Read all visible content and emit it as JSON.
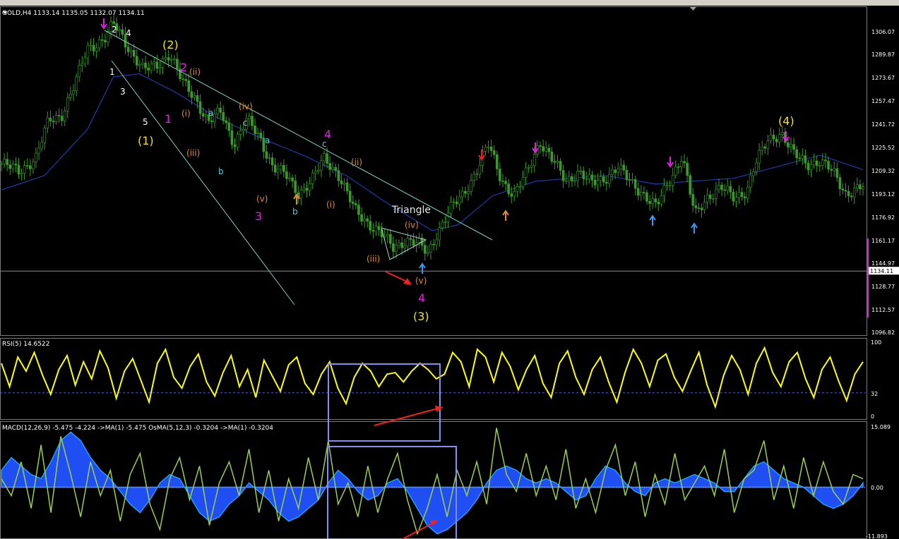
{
  "header": {
    "main": "GOLD,H4  1133.14 1135.05 1132.07 1134.11",
    "rsi": "RSI(5) 14.6522",
    "macd": "MACD(12,26,9) -5.475 -4.224  ->MA(1) -5.475  OsMA(5,12,3) -0.3204  ->MA(1) -0.3204"
  },
  "colors": {
    "background": "#000000",
    "candles": "#3a9a2a",
    "moving_average": "#1e3aa8",
    "trendline": "#7ad4c0",
    "wave_yellow": "#f0e020",
    "wave_magenta": "#e020e0",
    "wave_orange": "#e08a3a",
    "wave_cyan": "#5ac8d8",
    "rsi_line": "#ffff00",
    "macd_line": "#9ed04a",
    "macd_histogram": "#1f4ff2",
    "macd_fill": "#20a0ff",
    "highlight_box": "#8c8cf0",
    "arrow_red": "#ee2222"
  },
  "chart_data": [
    {
      "type": "candlestick",
      "name": "GOLD,H4",
      "ylim": [
        1090,
        1316
      ],
      "y_ticks": [
        "1306.07",
        "1289.87",
        "1273.67",
        "1257.47",
        "1241.72",
        "1225.52",
        "1209.32",
        "1193.12",
        "1176.92",
        "1161.17",
        "1144.97",
        "1128.77",
        "1112.57",
        "1096.82"
      ],
      "current_price": "1134.11",
      "current_price_value": 1134.11,
      "price_path": [
        [
          0.0,
          1208
        ],
        [
          0.02,
          1203
        ],
        [
          0.04,
          1212
        ],
        [
          0.055,
          1238
        ],
        [
          0.07,
          1242
        ],
        [
          0.085,
          1262
        ],
        [
          0.1,
          1288
        ],
        [
          0.12,
          1294
        ],
        [
          0.13,
          1304
        ],
        [
          0.14,
          1296
        ],
        [
          0.15,
          1286
        ],
        [
          0.165,
          1272
        ],
        [
          0.18,
          1276
        ],
        [
          0.195,
          1284
        ],
        [
          0.21,
          1264
        ],
        [
          0.225,
          1254
        ],
        [
          0.24,
          1236
        ],
        [
          0.255,
          1244
        ],
        [
          0.27,
          1222
        ],
        [
          0.285,
          1238
        ],
        [
          0.3,
          1226
        ],
        [
          0.315,
          1206
        ],
        [
          0.33,
          1200
        ],
        [
          0.345,
          1188
        ],
        [
          0.36,
          1196
        ],
        [
          0.375,
          1212
        ],
        [
          0.39,
          1202
        ],
        [
          0.41,
          1176
        ],
        [
          0.425,
          1168
        ],
        [
          0.44,
          1160
        ],
        [
          0.455,
          1150
        ],
        [
          0.47,
          1156
        ],
        [
          0.485,
          1152
        ],
        [
          0.495,
          1146
        ],
        [
          0.505,
          1160
        ],
        [
          0.52,
          1176
        ],
        [
          0.535,
          1186
        ],
        [
          0.55,
          1202
        ],
        [
          0.565,
          1221
        ],
        [
          0.58,
          1198
        ],
        [
          0.595,
          1186
        ],
        [
          0.61,
          1202
        ],
        [
          0.625,
          1224
        ],
        [
          0.64,
          1210
        ],
        [
          0.655,
          1196
        ],
        [
          0.67,
          1203
        ],
        [
          0.685,
          1194
        ],
        [
          0.7,
          1198
        ],
        [
          0.715,
          1206
        ],
        [
          0.73,
          1195
        ],
        [
          0.745,
          1188
        ],
        [
          0.76,
          1178
        ],
        [
          0.775,
          1196
        ],
        [
          0.79,
          1214
        ],
        [
          0.805,
          1172
        ],
        [
          0.82,
          1186
        ],
        [
          0.835,
          1192
        ],
        [
          0.85,
          1184
        ],
        [
          0.865,
          1190
        ],
        [
          0.875,
          1208
        ],
        [
          0.89,
          1224
        ],
        [
          0.905,
          1230
        ],
        [
          0.92,
          1214
        ],
        [
          0.935,
          1208
        ],
        [
          0.95,
          1210
        ],
        [
          0.965,
          1202
        ],
        [
          0.98,
          1188
        ],
        [
          1.0,
          1192
        ]
      ],
      "moving_average_path": [
        [
          0.0,
          1190
        ],
        [
          0.05,
          1200
        ],
        [
          0.1,
          1232
        ],
        [
          0.13,
          1268
        ],
        [
          0.16,
          1270
        ],
        [
          0.2,
          1258
        ],
        [
          0.25,
          1240
        ],
        [
          0.3,
          1226
        ],
        [
          0.35,
          1214
        ],
        [
          0.4,
          1200
        ],
        [
          0.45,
          1180
        ],
        [
          0.5,
          1162
        ],
        [
          0.53,
          1166
        ],
        [
          0.57,
          1186
        ],
        [
          0.62,
          1196
        ],
        [
          0.7,
          1200
        ],
        [
          0.76,
          1194
        ],
        [
          0.8,
          1196
        ],
        [
          0.85,
          1198
        ],
        [
          0.9,
          1206
        ],
        [
          0.95,
          1214
        ],
        [
          1.0,
          1204
        ]
      ]
    },
    {
      "type": "line",
      "name": "RSI(5)",
      "ylim": [
        0,
        100
      ],
      "y_ticks": [
        "100",
        "32",
        "0"
      ],
      "level": 32,
      "values": [
        70,
        40,
        78,
        60,
        84,
        55,
        30,
        62,
        80,
        42,
        72,
        50,
        86,
        64,
        25,
        60,
        76,
        48,
        20,
        70,
        88,
        52,
        38,
        66,
        82,
        46,
        28,
        58,
        80,
        40,
        62,
        26,
        74,
        54,
        34,
        68,
        78,
        44,
        30,
        56,
        72,
        38,
        18,
        52,
        70,
        60,
        40,
        56,
        58,
        46,
        60,
        70,
        62,
        50,
        56,
        84,
        72,
        40,
        88,
        78,
        46,
        84,
        66,
        36,
        62,
        80,
        44,
        26,
        70,
        86,
        52,
        30,
        62,
        78,
        46,
        20,
        58,
        88,
        70,
        40,
        74,
        82,
        52,
        34,
        60,
        84,
        42,
        14,
        54,
        80,
        62,
        30,
        70,
        90,
        58,
        40,
        72,
        84,
        50,
        26,
        62,
        78,
        48,
        22,
        56,
        72
      ]
    },
    {
      "type": "bar",
      "name": "MACD(12,26,9)",
      "ylim": [
        -11.893,
        15.089
      ],
      "y_ticks": [
        "15.089",
        "0.00",
        "-11.893"
      ],
      "histogram": [
        4,
        7,
        5,
        3,
        2,
        6,
        11,
        13,
        11,
        7,
        4,
        2,
        -1,
        -4,
        -6,
        -3,
        1,
        3,
        2,
        -2,
        -6,
        -8,
        -7,
        -4,
        -2,
        1,
        -1,
        -3,
        -6,
        -8,
        -7,
        -5,
        -3,
        1,
        4,
        2,
        -1,
        -3,
        -2,
        1,
        2,
        -1,
        -5,
        -9,
        -11,
        -10,
        -8,
        -6,
        -3,
        1,
        4,
        5,
        4,
        2,
        1,
        2,
        1,
        -1,
        -3,
        -2,
        2,
        5,
        4,
        1,
        -1,
        -2,
        1,
        2,
        1,
        2,
        3,
        2,
        1,
        -1,
        -1,
        2,
        5,
        6,
        4,
        2,
        1,
        0,
        -2,
        -4,
        -5,
        -4,
        -2,
        1
      ],
      "signal": [
        2,
        -2,
        6,
        -5,
        10,
        -6,
        12,
        3,
        -7,
        6,
        -2,
        4,
        -8,
        3,
        8,
        -4,
        -10,
        2,
        7,
        -3,
        5,
        -9,
        1,
        6,
        -2,
        9,
        -6,
        4,
        -8,
        2,
        -5,
        7,
        -3,
        11,
        -4,
        1,
        -7,
        5,
        -6,
        2,
        8,
        -3,
        -11,
        -5,
        3,
        -7,
        4,
        -2,
        6,
        -4,
        14,
        3,
        -1,
        8,
        -2,
        5,
        -3,
        9,
        -5,
        2,
        -6,
        4,
        10,
        -2,
        6,
        -7,
        3,
        -4,
        8,
        -3,
        1,
        5,
        -2,
        9,
        -6,
        2,
        4,
        11,
        -3,
        5,
        -5,
        7,
        -2,
        6,
        -1,
        -4,
        3,
        2
      ]
    }
  ],
  "annotations": {
    "wave_labels": [
      {
        "text": "(2)",
        "color": "yellow"
      },
      {
        "text": "(1)",
        "color": "yellow"
      },
      {
        "text": "(3)",
        "color": "yellow"
      },
      {
        "text": "(4)",
        "color": "yellow"
      },
      {
        "text": "2",
        "color": "magenta"
      },
      {
        "text": "1",
        "color": "magenta"
      },
      {
        "text": "3",
        "color": "magenta"
      },
      {
        "text": "4",
        "color": "magenta"
      },
      {
        "text": "4",
        "color": "magenta"
      },
      {
        "text": "(ii)",
        "color": "orange"
      },
      {
        "text": "(i)",
        "color": "orange"
      },
      {
        "text": "(iii)",
        "color": "orange"
      },
      {
        "text": "(iv)",
        "color": "orange"
      },
      {
        "text": "(v)",
        "color": "orange"
      },
      {
        "text": "(ii)",
        "color": "orange"
      },
      {
        "text": "(i)",
        "color": "orange"
      },
      {
        "text": "(iv)",
        "color": "orange"
      },
      {
        "text": "(iii)",
        "color": "orange"
      },
      {
        "text": "(v)",
        "color": "orange"
      },
      {
        "text": "a",
        "color": "cyan"
      },
      {
        "text": "b",
        "color": "cyan"
      },
      {
        "text": "c",
        "color": "cyan"
      },
      {
        "text": "a",
        "color": "cyan"
      },
      {
        "text": "b",
        "color": "cyan"
      },
      {
        "text": "c",
        "color": "cyan"
      },
      {
        "text": "2",
        "color": "white"
      },
      {
        "text": "4",
        "color": "white"
      },
      {
        "text": "1",
        "color": "white"
      },
      {
        "text": "3",
        "color": "white"
      },
      {
        "text": "5",
        "color": "white"
      }
    ],
    "triangle_label": "Triangle",
    "fractal_arrows": [
      "down-magenta",
      "down-red",
      "down-magenta",
      "down-magenta",
      "down-magenta",
      "up-orange",
      "up-blue",
      "up-blue",
      "up-orange",
      "up-blue"
    ]
  }
}
